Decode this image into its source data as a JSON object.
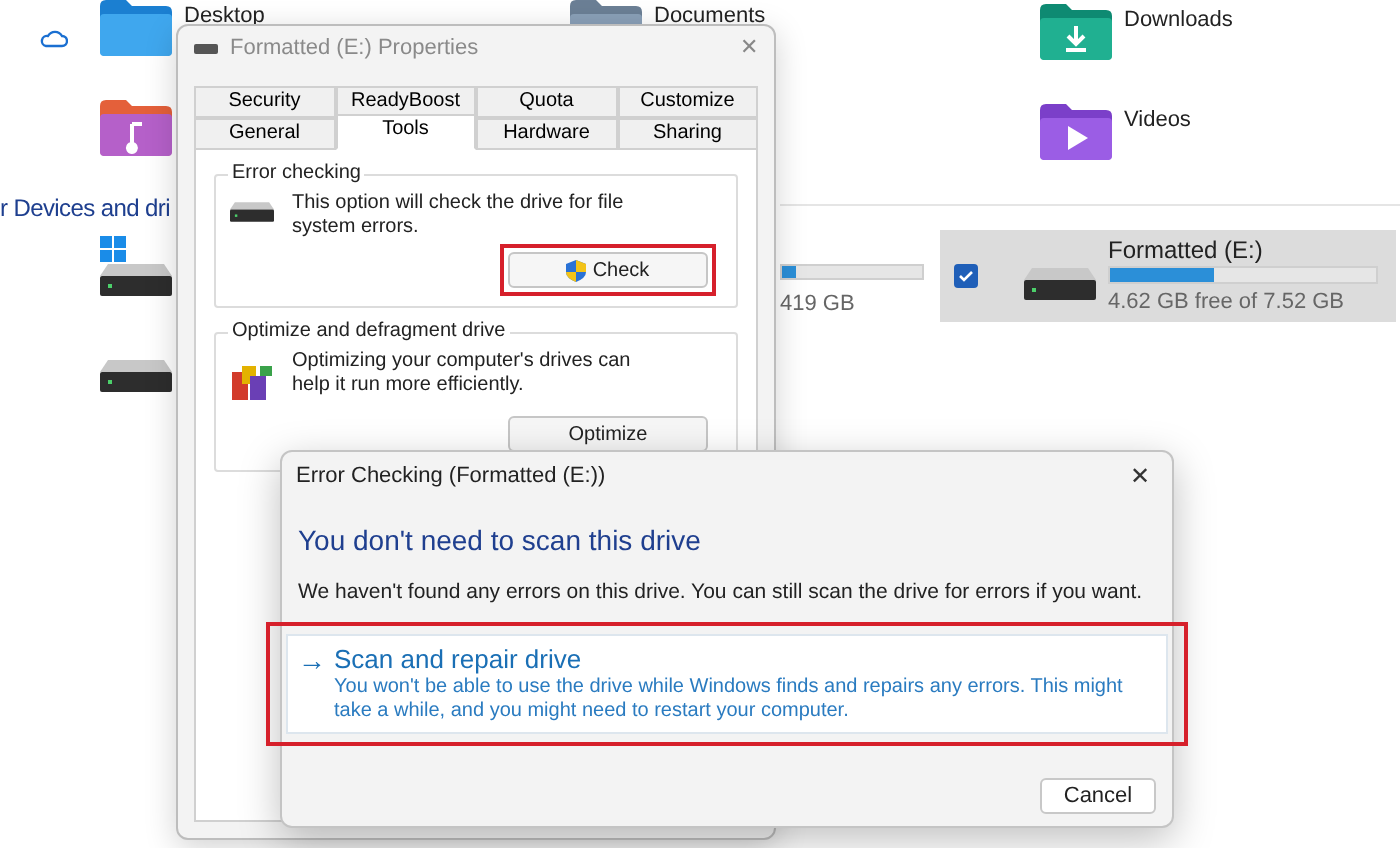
{
  "explorer": {
    "folders": [
      {
        "kind": "onedrive"
      },
      {
        "kind": "desktop",
        "label": "Desktop"
      },
      {
        "kind": "documents",
        "label": "Documents"
      },
      {
        "kind": "downloads",
        "label": "Downloads"
      },
      {
        "kind": "music"
      },
      {
        "kind": "videos",
        "label": "Videos"
      }
    ],
    "section_heading": "r Devices and dri",
    "drives": [
      {
        "kind": "system",
        "level": 0.1,
        "reading": "419 GB",
        "selected": false
      },
      {
        "kind": "plain",
        "selected": false
      },
      {
        "kind": "removable",
        "name": "Formatted (E:)",
        "level": 0.39,
        "reading": "4.62 GB free of 7.52 GB",
        "selected": true,
        "checked": true
      }
    ]
  },
  "properties": {
    "title": "Formatted (E:) Properties",
    "close": "✕",
    "tab_rows": [
      [
        {
          "label": "Security",
          "selected": false
        },
        {
          "label": "ReadyBoost",
          "selected": false
        },
        {
          "label": "Quota",
          "selected": false
        },
        {
          "label": "Customize",
          "selected": false
        }
      ],
      [
        {
          "label": "General",
          "selected": false
        },
        {
          "label": "Tools",
          "selected": true
        },
        {
          "label": "Hardware",
          "selected": false
        },
        {
          "label": "Sharing",
          "selected": false
        }
      ]
    ],
    "groups": [
      {
        "kind": "error_checking",
        "title": "Error checking",
        "text": "This option will check the drive for file system errors.",
        "button": {
          "label": "Check",
          "shield": true,
          "highlighted": true
        }
      },
      {
        "kind": "optimize",
        "title": "Optimize and defragment drive",
        "text": "Optimizing your computer's drives can help it run more efficiently.",
        "button": {
          "label": "Optimize",
          "shield": false,
          "highlighted": false
        }
      }
    ]
  },
  "error_dialog": {
    "title": "Error Checking (Formatted (E:))",
    "close": "✕",
    "heading": "You don't need to scan this drive",
    "message": "We haven't found any errors on this drive. You can still scan the drive for errors if you want.",
    "option": {
      "arrow": "→",
      "title": "Scan and repair drive",
      "description": "You won't be able to use the drive while Windows finds and repairs any errors. This might take a while, and you might need to restart your computer.",
      "highlighted": true
    },
    "button": "Cancel"
  }
}
